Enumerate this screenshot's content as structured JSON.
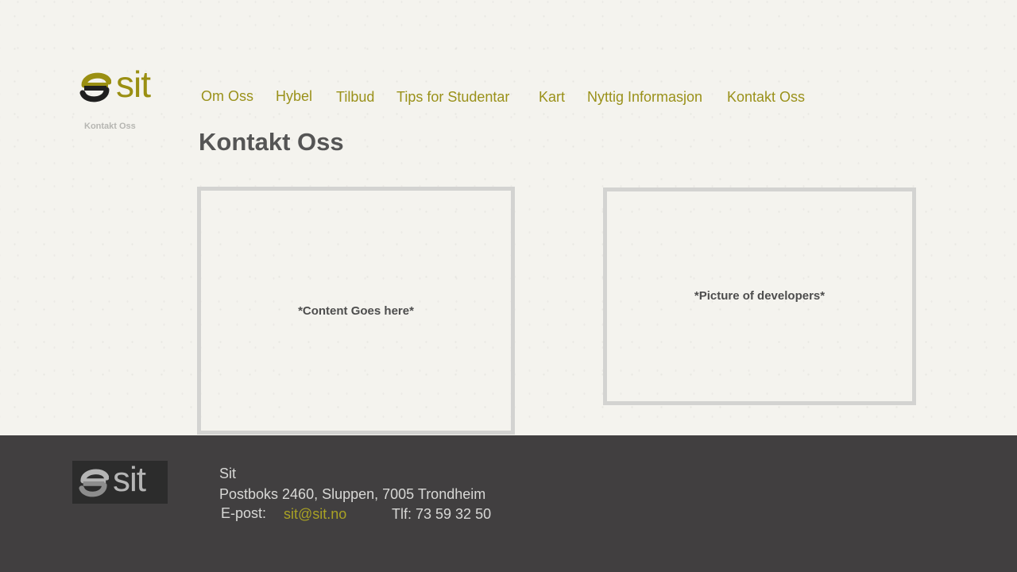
{
  "header": {
    "logo_text": "sit",
    "breadcrumb": "Kontakt Oss"
  },
  "nav": {
    "items": [
      {
        "label": "Om Oss"
      },
      {
        "label": "Hybel"
      },
      {
        "label": "Tilbud"
      },
      {
        "label": "Tips for Studentar"
      },
      {
        "label": "Kart"
      },
      {
        "label": "Nyttig Informasjon"
      },
      {
        "label": "Kontakt Oss"
      }
    ]
  },
  "main": {
    "title": "Kontakt Oss",
    "content_placeholder": "*Content Goes here*",
    "picture_placeholder": "*Picture of developers*"
  },
  "footer": {
    "logo_text": "sit",
    "name": "Sit",
    "address": "Postboks 2460, Sluppen, 7005 Trondheim",
    "email_label": "E-post:",
    "email": "sit@sit.no",
    "phone": "Tlf: 73 59 32 50"
  },
  "colors": {
    "accent": "#9a911a",
    "background": "#f4f3ee",
    "footer_background": "#413f40",
    "panel_border": "#d3d3d1",
    "title": "#555555"
  },
  "icons": {
    "logo_mark": "sit-swirl-icon"
  }
}
